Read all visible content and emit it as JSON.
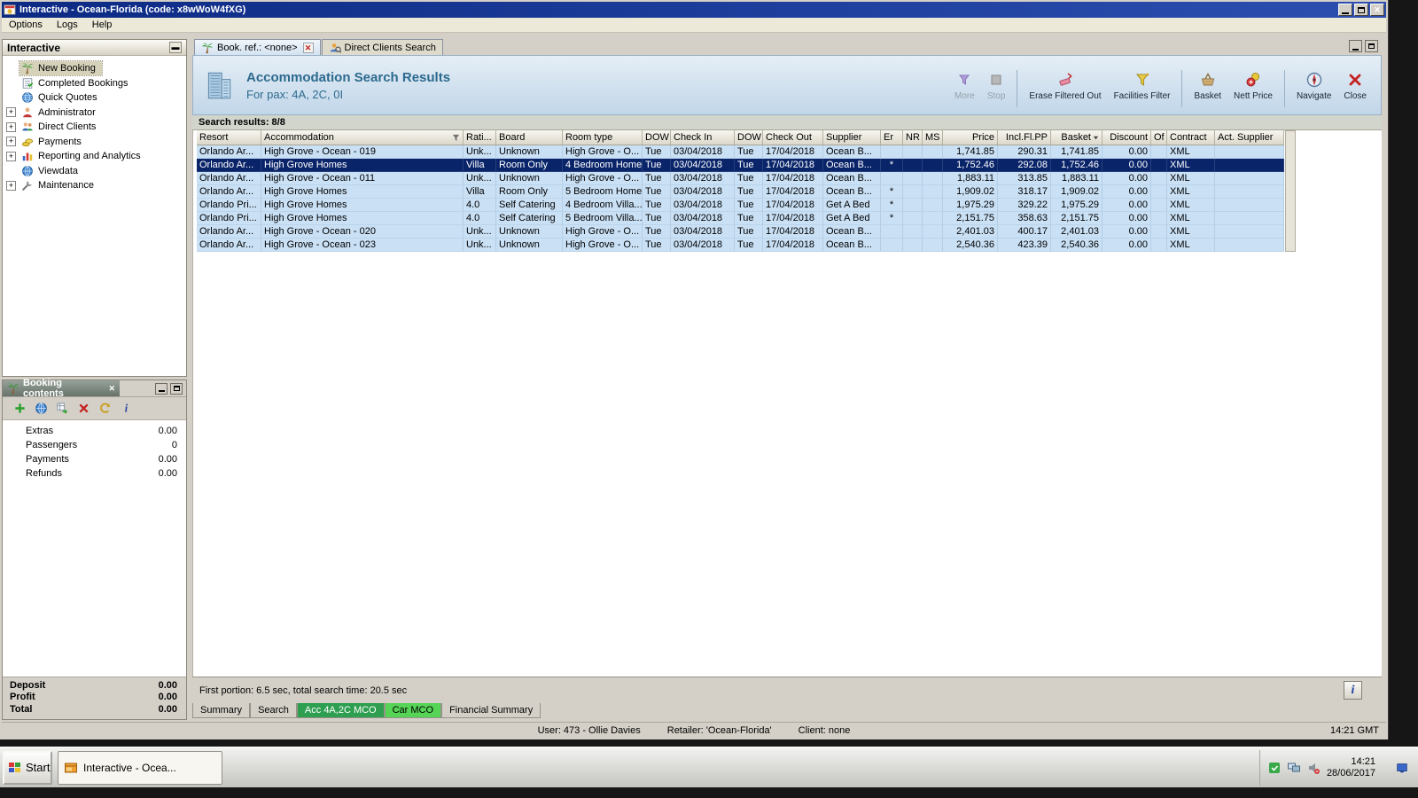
{
  "titlebar": {
    "title": "Interactive - Ocean-Florida (code: x8wWoW4fXG)"
  },
  "menubar": {
    "items": [
      "Options",
      "Logs",
      "Help"
    ]
  },
  "sidebar": {
    "title": "Interactive",
    "items": [
      {
        "label": "New Booking",
        "icon": "palm",
        "expander": false,
        "selected": true
      },
      {
        "label": "Completed Bookings",
        "icon": "tasks",
        "expander": false
      },
      {
        "label": "Quick Quotes",
        "icon": "globe-clock",
        "expander": false
      },
      {
        "label": "Administrator",
        "icon": "person",
        "expander": true
      },
      {
        "label": "Direct Clients",
        "icon": "people",
        "expander": true
      },
      {
        "label": "Payments",
        "icon": "coins",
        "expander": true
      },
      {
        "label": "Reporting and Analytics",
        "icon": "chart",
        "expander": true
      },
      {
        "label": "Viewdata",
        "icon": "globe",
        "expander": false
      },
      {
        "label": "Maintenance",
        "icon": "wrench",
        "expander": true
      }
    ]
  },
  "booking_contents": {
    "title": "Booking contents",
    "toolbar_icons": [
      "add",
      "globe",
      "import",
      "delete",
      "revert",
      "info"
    ],
    "rows": [
      {
        "label": "Extras",
        "value": "0.00"
      },
      {
        "label": "Passengers",
        "value": "0"
      },
      {
        "label": "Payments",
        "value": "0.00"
      },
      {
        "label": "Refunds",
        "value": "0.00"
      }
    ],
    "totals": [
      {
        "label": "Deposit",
        "value": "0.00"
      },
      {
        "label": "Profit",
        "value": "0.00"
      },
      {
        "label": "Total",
        "value": "0.00"
      }
    ]
  },
  "doc_tabs": [
    {
      "label": "Book. ref.: <none>",
      "icon": "palm",
      "active": true,
      "closable": true
    },
    {
      "label": "Direct Clients Search",
      "icon": "search-person",
      "active": false,
      "closable": false
    }
  ],
  "results_header": {
    "title": "Accommodation Search Results",
    "subtitle": "For pax: 4A, 2C, 0I"
  },
  "action_toolbar": [
    {
      "label": "More",
      "icon": "more",
      "disabled": true
    },
    {
      "label": "Stop",
      "icon": "stop",
      "disabled": true,
      "group_end": true
    },
    {
      "label": "Erase Filtered Out",
      "icon": "eraser",
      "disabled": false
    },
    {
      "label": "Facilities Filter",
      "icon": "facilities-funnel",
      "disabled": false,
      "group_end": true
    },
    {
      "label": "Basket",
      "icon": "basket",
      "disabled": false
    },
    {
      "label": "Nett Price",
      "icon": "nett-price",
      "disabled": false,
      "group_end": true
    },
    {
      "label": "Navigate",
      "icon": "navigate",
      "disabled": false
    },
    {
      "label": "Close",
      "icon": "close-red",
      "disabled": false
    }
  ],
  "results": {
    "count_label": "Search results: 8/8",
    "columns": [
      {
        "label": "Resort"
      },
      {
        "label": "Accommodation",
        "filter": true
      },
      {
        "label": "Rati..."
      },
      {
        "label": "Board"
      },
      {
        "label": "Room type"
      },
      {
        "label": "DOW"
      },
      {
        "label": "Check In"
      },
      {
        "label": "DOW"
      },
      {
        "label": "Check Out"
      },
      {
        "label": "Supplier"
      },
      {
        "label": "Er"
      },
      {
        "label": "NR"
      },
      {
        "label": "MS"
      },
      {
        "label": "Price"
      },
      {
        "label": "Incl.Fl.PP"
      },
      {
        "label": "Basket",
        "sort": "desc"
      },
      {
        "label": "Discount"
      },
      {
        "label": "Of"
      },
      {
        "label": "Contract"
      },
      {
        "label": "Act. Supplier"
      }
    ],
    "selected_row_index": 1,
    "rows": [
      [
        "Orlando Ar...",
        "High Grove - Ocean - 019",
        "Unk...",
        "Unknown",
        "High Grove - O...",
        "Tue",
        "03/04/2018",
        "Tue",
        "17/04/2018",
        "Ocean B...",
        "",
        "",
        "",
        "1,741.85",
        "290.31",
        "1,741.85",
        "0.00",
        "",
        "XML",
        ""
      ],
      [
        "Orlando Ar...",
        "High Grove Homes",
        "Villa",
        "Room Only",
        "4 Bedroom Home",
        "Tue",
        "03/04/2018",
        "Tue",
        "17/04/2018",
        "Ocean B...",
        "*",
        "",
        "",
        "1,752.46",
        "292.08",
        "1,752.46",
        "0.00",
        "",
        "XML",
        ""
      ],
      [
        "Orlando Ar...",
        "High Grove - Ocean - 011",
        "Unk...",
        "Unknown",
        "High Grove - O...",
        "Tue",
        "03/04/2018",
        "Tue",
        "17/04/2018",
        "Ocean B...",
        "",
        "",
        "",
        "1,883.11",
        "313.85",
        "1,883.11",
        "0.00",
        "",
        "XML",
        ""
      ],
      [
        "Orlando Ar...",
        "High Grove Homes",
        "Villa",
        "Room Only",
        "5 Bedroom Home",
        "Tue",
        "03/04/2018",
        "Tue",
        "17/04/2018",
        "Ocean B...",
        "*",
        "",
        "",
        "1,909.02",
        "318.17",
        "1,909.02",
        "0.00",
        "",
        "XML",
        ""
      ],
      [
        "Orlando Pri...",
        "High Grove Homes",
        "4.0",
        "Self Catering",
        "4 Bedroom Villa...",
        "Tue",
        "03/04/2018",
        "Tue",
        "17/04/2018",
        "Get A Bed",
        "*",
        "",
        "",
        "1,975.29",
        "329.22",
        "1,975.29",
        "0.00",
        "",
        "XML",
        ""
      ],
      [
        "Orlando Pri...",
        "High Grove Homes",
        "4.0",
        "Self Catering",
        "5 Bedroom Villa...",
        "Tue",
        "03/04/2018",
        "Tue",
        "17/04/2018",
        "Get A Bed",
        "*",
        "",
        "",
        "2,151.75",
        "358.63",
        "2,151.75",
        "0.00",
        "",
        "XML",
        ""
      ],
      [
        "Orlando Ar...",
        "High Grove - Ocean - 020",
        "Unk...",
        "Unknown",
        "High Grove - O...",
        "Tue",
        "03/04/2018",
        "Tue",
        "17/04/2018",
        "Ocean B...",
        "",
        "",
        "",
        "2,401.03",
        "400.17",
        "2,401.03",
        "0.00",
        "",
        "XML",
        ""
      ],
      [
        "Orlando Ar...",
        "High Grove - Ocean - 023",
        "Unk...",
        "Unknown",
        "High Grove - O...",
        "Tue",
        "03/04/2018",
        "Tue",
        "17/04/2018",
        "Ocean B...",
        "",
        "",
        "",
        "2,540.36",
        "423.39",
        "2,540.36",
        "0.00",
        "",
        "XML",
        ""
      ]
    ]
  },
  "status_strip": {
    "text": "First portion: 6.5 sec, total search time: 20.5 sec"
  },
  "bottom_tabs": [
    {
      "label": "Summary",
      "style": "normal"
    },
    {
      "label": "Search",
      "style": "normal"
    },
    {
      "label": "Acc 4A,2C MCO",
      "style": "green-dark"
    },
    {
      "label": "Car MCO",
      "style": "green-bright"
    },
    {
      "label": "Financial Summary",
      "style": "normal"
    }
  ],
  "app_statusbar": {
    "user": "User: 473 - Ollie Davies",
    "retailer": "Retailer: 'Ocean-Florida'",
    "client": "Client: none",
    "time": "14:21 GMT"
  },
  "taskbar": {
    "start_label": "Start",
    "task_label": "Interactive - Ocea...",
    "tray_icons": [
      "tray-green",
      "tray-monitors",
      "tray-speaker"
    ],
    "clock_time": "14:21",
    "clock_date": "28/06/2017"
  }
}
